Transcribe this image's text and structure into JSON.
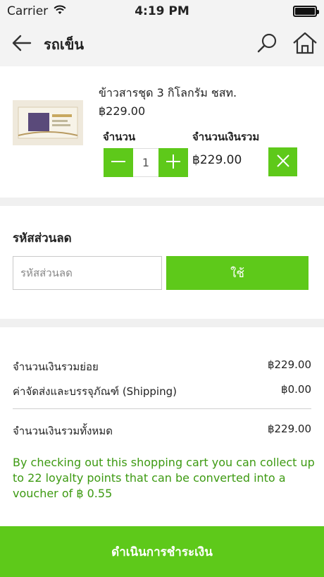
{
  "status_bar": {
    "carrier": "Carrier",
    "time": "4:19 PM"
  },
  "nav": {
    "title": "รถเข็น",
    "back_icon": "arrow-left-icon",
    "search_icon": "search-icon",
    "home_icon": "home-icon"
  },
  "cart": {
    "item_name": "ข้าวสารชุด 3 กิโลกรัม ชสท.",
    "item_price": "฿229.00",
    "qty_label": "จำนวน",
    "total_label": "จำนวนเงินรวม",
    "quantity": "1",
    "line_total": "฿229.00"
  },
  "coupon": {
    "title": "รหัสส่วนลด",
    "placeholder": "รหัสส่วนลด",
    "apply_label": "ใช้"
  },
  "summary": {
    "subtotal_label": "จำนวนเงินรวมย่อย",
    "subtotal_value": "฿229.00",
    "shipping_label": "ค่าจัดส่งและบรรจุภัณฑ์ (Shipping)",
    "shipping_value": "฿0.00",
    "total_label": "จำนวนเงินรวมทั้งหมด",
    "total_value": "฿229.00",
    "loyalty_text": "By checking out this shopping cart you can collect up to 22 loyalty points that can be converted into a voucher of ฿ 0.55"
  },
  "checkout": {
    "label": "ดำเนินการชำระเงิน"
  },
  "colors": {
    "accent": "#5ec91a",
    "loyalty_text": "#3d9a12"
  }
}
